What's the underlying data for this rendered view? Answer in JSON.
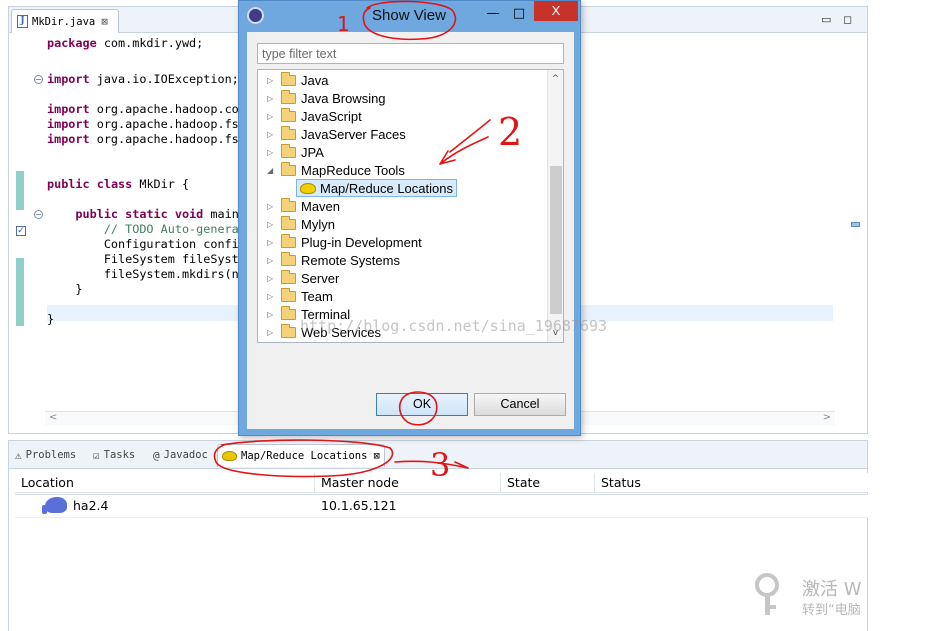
{
  "editor": {
    "tab_label": "MkDir.java",
    "tab_close": "⊠",
    "minimize": "▭",
    "maximize": "◻",
    "lines": [
      {
        "parts": [
          {
            "t": "package",
            "c": "kw"
          },
          {
            "t": " com.mkdir.ywd;",
            "c": ""
          }
        ]
      },
      {
        "parts": [
          {
            "t": "import",
            "c": "kw"
          },
          {
            "t": " java.io.IOException;",
            "c": ""
          }
        ]
      },
      {
        "parts": [
          {
            "t": "import",
            "c": "kw"
          },
          {
            "t": " org.apache.hadoop.con",
            "c": ""
          }
        ]
      },
      {
        "parts": [
          {
            "t": "import",
            "c": "kw"
          },
          {
            "t": " org.apache.hadoop.fs",
            "c": ""
          }
        ]
      },
      {
        "parts": [
          {
            "t": "import",
            "c": "kw"
          },
          {
            "t": " org.apache.hadoop.fs",
            "c": ""
          }
        ]
      },
      {
        "parts": [
          {
            "t": "public",
            "c": "kw"
          },
          {
            "t": " ",
            "c": ""
          },
          {
            "t": "class",
            "c": "kw"
          },
          {
            "t": " MkDir {",
            "c": ""
          }
        ]
      },
      {
        "parts": [
          {
            "t": "    public",
            "c": "kw"
          },
          {
            "t": " ",
            "c": ""
          },
          {
            "t": "static",
            "c": "kw"
          },
          {
            "t": " ",
            "c": ""
          },
          {
            "t": "void",
            "c": "kw"
          },
          {
            "t": " main",
            "c": ""
          }
        ]
      },
      {
        "parts": [
          {
            "t": "        // TODO Auto-generat",
            "c": "cm"
          }
        ]
      },
      {
        "parts": [
          {
            "t": "        Configuration config",
            "c": ""
          }
        ]
      },
      {
        "parts": [
          {
            "t": "        FileSystem fileSyste",
            "c": ""
          }
        ]
      },
      {
        "parts": [
          {
            "t": "        fileSystem.mkdirs(ne",
            "c": ""
          }
        ]
      },
      {
        "parts": [
          {
            "t": "    }",
            "c": ""
          }
        ]
      },
      {
        "parts": [
          {
            "t": "}",
            "c": ""
          }
        ]
      }
    ],
    "scroll_left": "<",
    "scroll_right": ">"
  },
  "dialog": {
    "title": "Show View",
    "minimize": "—",
    "maximize": "□",
    "close": "X",
    "filter_placeholder": "type filter text",
    "tree": [
      {
        "label": "Java",
        "expanded": false
      },
      {
        "label": "Java Browsing",
        "expanded": false
      },
      {
        "label": "JavaScript",
        "expanded": false
      },
      {
        "label": "JavaServer Faces",
        "expanded": false
      },
      {
        "label": "JPA",
        "expanded": false
      },
      {
        "label": "MapReduce Tools",
        "expanded": true
      },
      {
        "label": "Map/Reduce Locations",
        "child": true
      },
      {
        "label": "Maven",
        "expanded": false
      },
      {
        "label": "Mylyn",
        "expanded": false
      },
      {
        "label": "Plug-in Development",
        "expanded": false
      },
      {
        "label": "Remote Systems",
        "expanded": false
      },
      {
        "label": "Server",
        "expanded": false
      },
      {
        "label": "Team",
        "expanded": false
      },
      {
        "label": "Terminal",
        "expanded": false
      },
      {
        "label": "Web Services",
        "expanded": false
      }
    ],
    "scroll_up": "^",
    "scroll_down": "v",
    "ok_label": "OK",
    "cancel_label": "Cancel"
  },
  "bottom": {
    "tabs": [
      {
        "label": "Problems",
        "icon": "⚠"
      },
      {
        "label": "Tasks",
        "icon": "☑"
      },
      {
        "label": "Javadoc",
        "icon": "@"
      },
      {
        "label": "Map/Reduce Locations",
        "icon": "elephant",
        "close": "⊠"
      }
    ],
    "columns": [
      "Location",
      "Master node",
      "State",
      "Status"
    ],
    "rows": [
      {
        "location": "ha2.4",
        "master": "10.1.65.121",
        "state": "",
        "status": ""
      }
    ]
  },
  "annotations": {
    "mark1": "1",
    "mark2": "2",
    "mark3": "3",
    "watermark": "http://blog.csdn.net/sina_19687693",
    "activate_line1": "激活 W",
    "activate_line2": "转到“电脑"
  },
  "colors": {
    "keyword": "#7f0055",
    "comment": "#3f7f5f",
    "dialog_frame": "#6ea8de",
    "close_red": "#c7322a",
    "annotation_red": "#e01515"
  }
}
